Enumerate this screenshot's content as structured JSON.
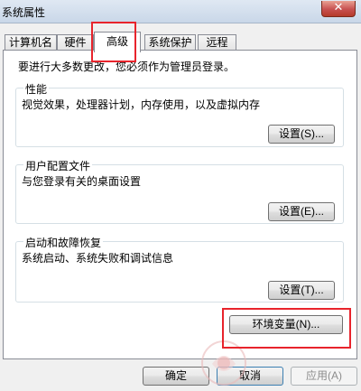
{
  "window": {
    "title": "系统属性",
    "close_glyph": "✕"
  },
  "tabs": [
    {
      "label": "计算机名"
    },
    {
      "label": "硬件"
    },
    {
      "label": "高级",
      "active": true
    },
    {
      "label": "系统保护"
    },
    {
      "label": "远程"
    }
  ],
  "advanced": {
    "intro": "要进行大多数更改，您必须作为管理员登录。",
    "performance": {
      "title": "性能",
      "description": "视觉效果，处理器计划，内存使用，以及虚拟内存",
      "button_label": "设置(S)..."
    },
    "user_profiles": {
      "title": "用户配置文件",
      "description": "与您登录有关的桌面设置",
      "button_label": "设置(E)..."
    },
    "startup_recovery": {
      "title": "启动和故障恢复",
      "description": "系统启动、系统失败和调试信息",
      "button_label": "设置(T)..."
    },
    "env_button_label": "环境变量(N)..."
  },
  "footer": {
    "ok_label": "确定",
    "cancel_label": "取消",
    "apply_label": "应用(A)"
  },
  "colors": {
    "highlight": "#e8242c",
    "panel": "#ffffff",
    "dialog": "#f0f0f0"
  }
}
